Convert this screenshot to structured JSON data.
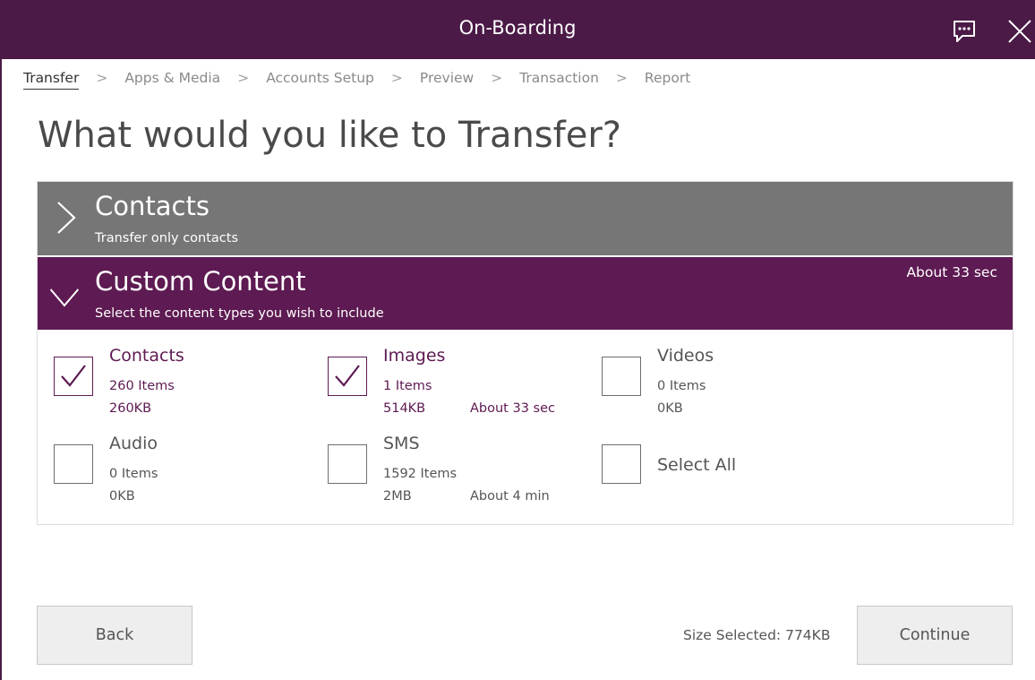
{
  "window": {
    "title": "On-Boarding"
  },
  "breadcrumb": {
    "items": [
      "Transfer",
      "Apps & Media",
      "Accounts Setup",
      "Preview",
      "Transaction",
      "Report"
    ],
    "separator": ">"
  },
  "heading": "What would you like to Transfer?",
  "sections": {
    "contacts": {
      "title": "Contacts",
      "subtitle": "Transfer only contacts",
      "expanded": false
    },
    "custom": {
      "title": "Custom Content",
      "subtitle": "Select the content types you wish to include",
      "estimate": "About 33 sec",
      "expanded": true
    }
  },
  "options": {
    "contacts": {
      "name": "Contacts",
      "count": "260 Items",
      "size": "260KB",
      "time": "",
      "checked": true
    },
    "images": {
      "name": "Images",
      "count": "1 Items",
      "size": "514KB",
      "time": "About 33 sec",
      "checked": true
    },
    "videos": {
      "name": "Videos",
      "count": "0 Items",
      "size": "0KB",
      "time": "",
      "checked": false
    },
    "audio": {
      "name": "Audio",
      "count": "0 Items",
      "size": "0KB",
      "time": "",
      "checked": false
    },
    "sms": {
      "name": "SMS",
      "count": "1592 Items",
      "size": "2MB",
      "time": "About 4 min",
      "checked": false
    },
    "select_all": {
      "name": "Select All",
      "checked": false
    }
  },
  "footer": {
    "back_label": "Back",
    "size_selected": "Size Selected: 774KB",
    "continue_label": "Continue"
  },
  "icons": {
    "chat": "chat-bubble-icon",
    "close": "close-icon",
    "collapsed": "chevron-right-icon",
    "expanded": "chevron-down-icon",
    "check": "checkmark-icon"
  },
  "colors": {
    "brand": "#4b1a47",
    "section_active": "#5e1a52",
    "section_inactive": "#767676"
  }
}
